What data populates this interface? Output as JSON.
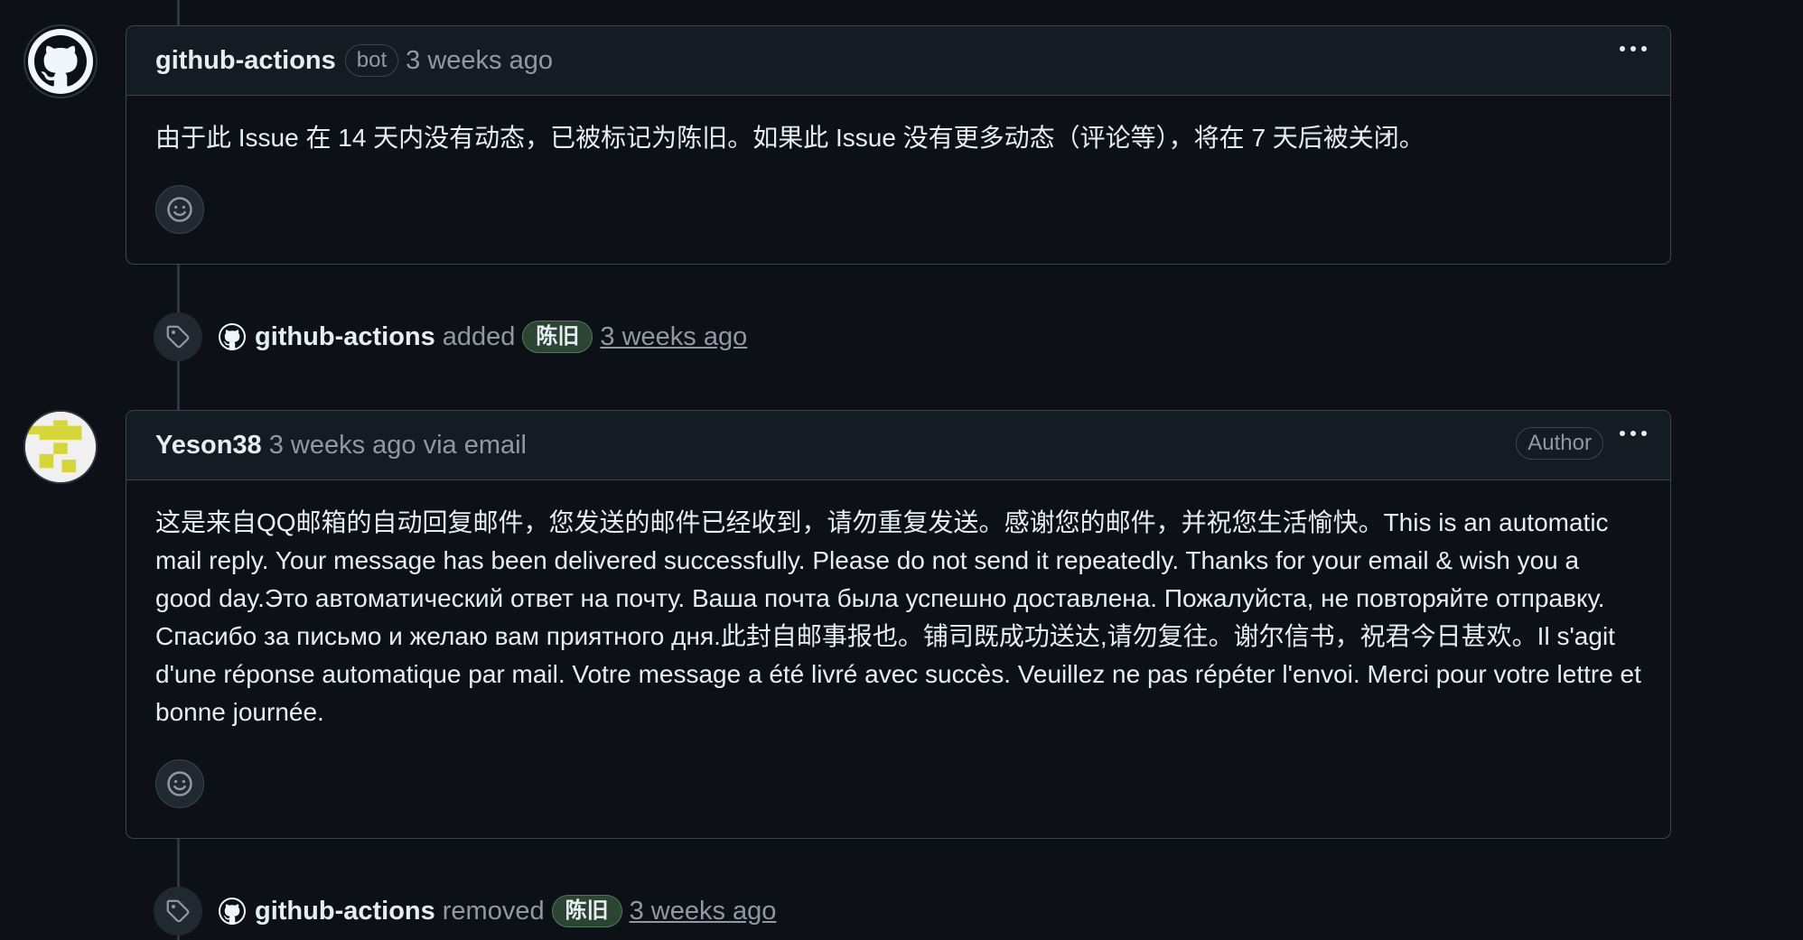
{
  "comments": [
    {
      "author": "github-actions",
      "badge": "bot",
      "time": "3 weeks ago",
      "body": "由于此 Issue 在 14 天内没有动态，已被标记为陈旧。如果此 Issue 没有更多动态（评论等），将在 7 天后被关闭。"
    },
    {
      "author": "Yeson38",
      "time": "3 weeks ago via email",
      "role_badge": "Author",
      "body": "这是来自QQ邮箱的自动回复邮件，您发送的邮件已经收到，请勿重复发送。感谢您的邮件，并祝您生活愉快。This is an automatic mail reply. Your message has been delivered successfully. Please do not send it repeatedly. Thanks for your email & wish you a good day.Это автоматический ответ на почту. Ваша почта была успешно доставлена. Пожалуйста, не повторяйте отправку. Спасибо за письмо и желаю вам приятного дня.此封自邮事报也。铺司既成功送达,请勿复往。谢尔信书，祝君今日甚欢。Il s'agit d'une réponse automatique par mail. Votre message a été livré avec succès. Veuillez ne pas répéter l'envoi. Merci pour votre lettre et bonne journée."
    }
  ],
  "events": [
    {
      "actor": "github-actions",
      "action": "added",
      "label": "陈旧",
      "time": "3 weeks ago"
    },
    {
      "actor": "github-actions",
      "action": "removed",
      "label": "陈旧",
      "time": "3 weeks ago"
    }
  ],
  "colors": {
    "label_bg": "#2c4432",
    "background": "#0d1117"
  }
}
